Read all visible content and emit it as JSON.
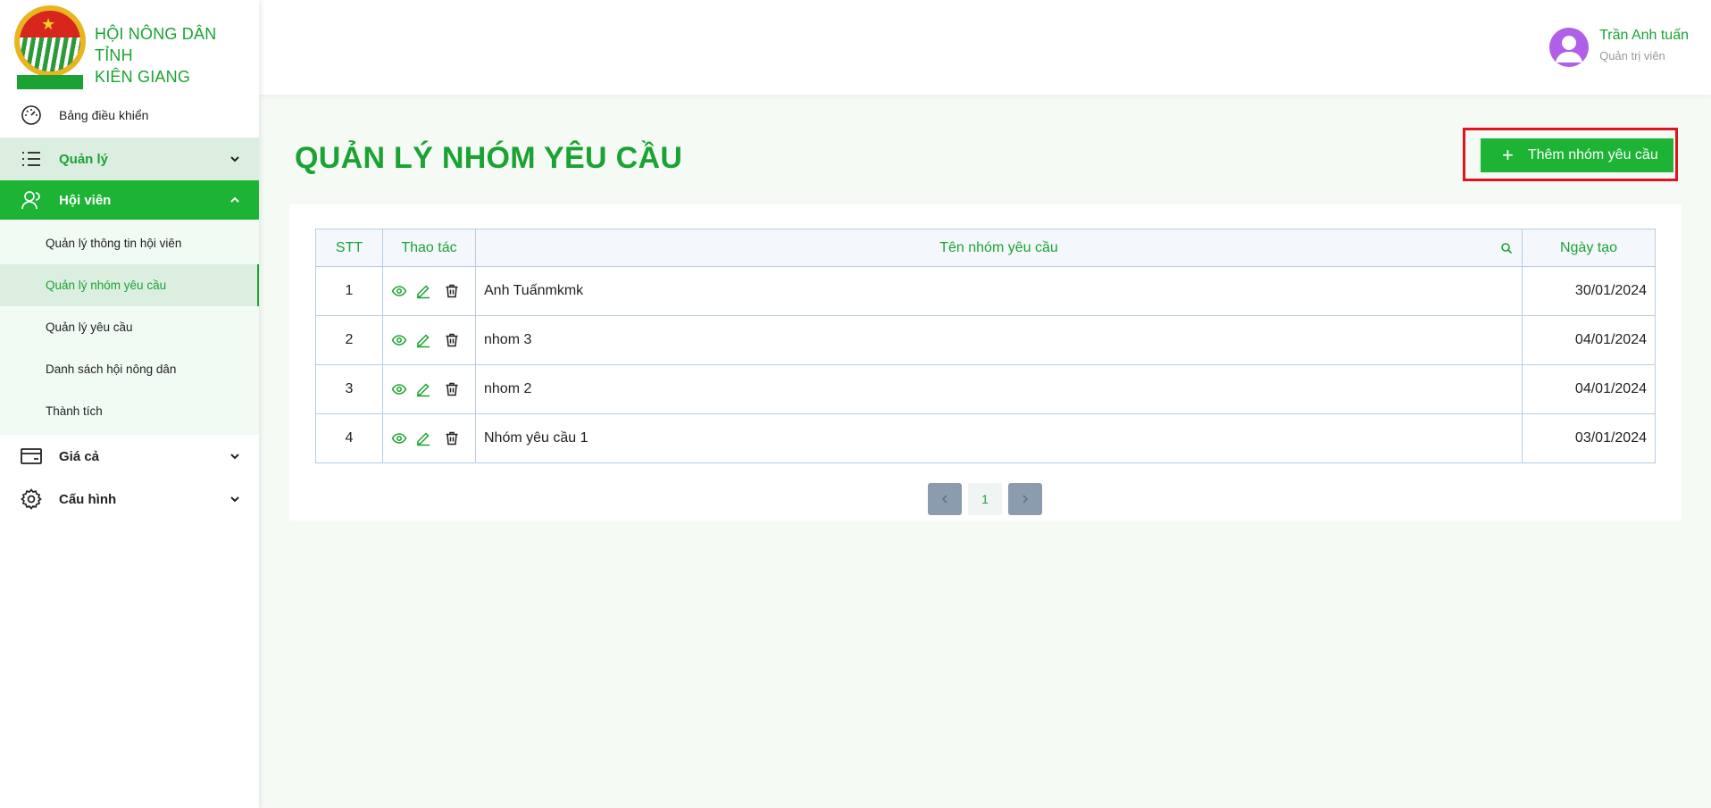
{
  "brand": {
    "title_line1": "HỘI NÔNG DÂN TỈNH",
    "title_line2": "KIÊN GIANG",
    "logo_text": "HỘI NÔNG DÂN TỈNH KIÊN GIANG"
  },
  "sidebar": {
    "dashboard": "Bảng điều khiển",
    "quanly": "Quản lý",
    "hoivien": "Hội viên",
    "sub_items": [
      "Quản lý thông tin hội viên",
      "Quản lý nhóm yêu cầu",
      "Quản lý yêu cầu",
      "Danh sách hội nông dân",
      "Thành tích"
    ],
    "giaca": "Giá cả",
    "cauhinh": "Cấu hình"
  },
  "user": {
    "name": "Trần Anh tuấn",
    "role": "Quản trị viên"
  },
  "page": {
    "title": "QUẢN LÝ NHÓM YÊU CẦU",
    "add_button": "Thêm nhóm yêu cầu"
  },
  "table": {
    "headers": [
      "STT",
      "Thao tác",
      "Tên nhóm yêu cầu",
      "Ngày tạo"
    ],
    "rows": [
      {
        "stt": "1",
        "name": "Anh Tuấnmkmk",
        "date": "30/01/2024"
      },
      {
        "stt": "2",
        "name": "nhom 3",
        "date": "04/01/2024"
      },
      {
        "stt": "3",
        "name": "nhom 2",
        "date": "04/01/2024"
      },
      {
        "stt": "4",
        "name": "Nhóm yêu cầu 1",
        "date": "03/01/2024"
      }
    ]
  },
  "pagination": {
    "current_page": "1"
  },
  "colors": {
    "brand_green": "#1aa332",
    "active_green": "#1db335",
    "highlight_red": "#e0141e"
  }
}
